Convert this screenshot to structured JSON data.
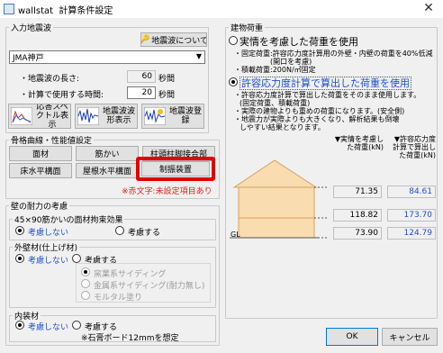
{
  "window": {
    "app": "wallstat",
    "title": "計算条件設定",
    "close": "✕"
  },
  "input_wave": {
    "group": "入力地震波",
    "about_btn": "地震波について",
    "selected_wave": "JMA神戸",
    "length_label": "・地震波の長さ:",
    "length_value": "60",
    "length_unit": "秒間",
    "calc_time_label": "・計算で使用する時間:",
    "calc_time_value": "20",
    "calc_time_unit": "秒間",
    "btn_spectrum": "応答スペクトル表示",
    "btn_waveform": "地震波波形表示",
    "btn_register": "地震波登録"
  },
  "frame": {
    "group": "骨格曲線・性能値設定",
    "btn_face": "面材",
    "btn_brace": "筋かい",
    "btn_joint": "柱頭柱脚接合部",
    "btn_floor": "床水平構面",
    "btn_roof": "屋根水平構面",
    "btn_damper": "制振装置",
    "note": "※赤文字:未設定項目あり"
  },
  "wall": {
    "group": "壁の耐力の考慮",
    "sub1": "45×90筋かいの面材拘束効果",
    "opt_none": "考慮しない",
    "opt_consider": "考慮する",
    "sub2": "外壁材(仕上げ材)",
    "ext_opt_none": "考慮しない",
    "ext_opt_consider": "考慮する",
    "ext_sub1": "窯業系サイディング",
    "ext_sub2": "金属系サイディング(耐力無し)",
    "ext_sub3": "モルタル塗り",
    "sub3": "内装材",
    "int_opt_none": "考慮しない",
    "int_opt_consider": "考慮する",
    "int_note": "※石膏ボード12mmを想定"
  },
  "load": {
    "group": "建物荷重",
    "opt1": "実情を考慮した荷重を使用",
    "opt1_desc1": "・固定荷重:許容応力度計算用の外壁・内壁の荷重を40%低減",
    "opt1_desc1b": "(開口を考慮)",
    "opt1_desc2": "・積載荷重:200N/㎡固定",
    "opt2": "許容応力度計算で算出した荷重を使用",
    "opt2_desc1": "・許容応力度計算で算出した荷重をそのまま使用します。",
    "opt2_desc1b": "(固定荷重、積載荷重)",
    "opt2_desc2": "・実際の建物よりも重めの荷重になります。(安全側)",
    "opt2_desc3": "・地震力が実際よりも大きくなり、解析結果も倒壊",
    "opt2_desc3b": "しやすい結果となります。",
    "col1_head": "▼実情を考慮した荷重(kN)",
    "col2_head": "▼許容応力度計算で算出した荷重(kN)",
    "gl": "GL",
    "rows": [
      {
        "actual": "71.35",
        "calc": "84.61"
      },
      {
        "actual": "118.82",
        "calc": "173.70"
      },
      {
        "actual": "73.90",
        "calc": "124.79"
      }
    ]
  },
  "footer": {
    "ok": "OK",
    "cancel": "キャンセル"
  }
}
